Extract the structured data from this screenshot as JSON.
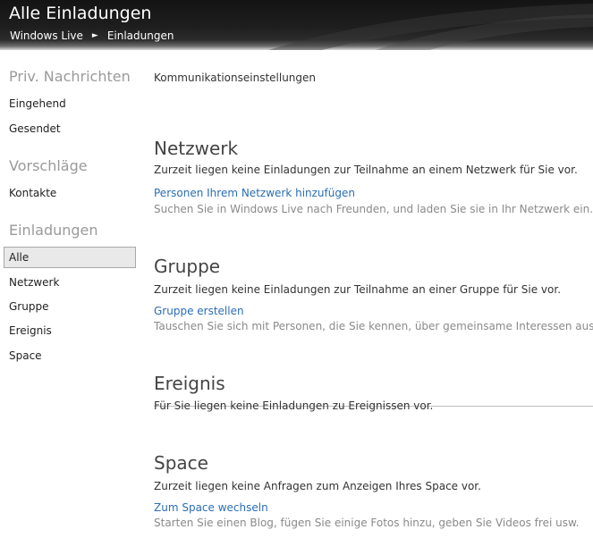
{
  "header": {
    "title": "Alle Einladungen",
    "breadcrumb": {
      "root": "Windows Live",
      "separator": "►",
      "current": "Einladungen"
    }
  },
  "sidebar": {
    "group_messages": {
      "heading": "Priv. Nachrichten",
      "items": [
        "Eingehend",
        "Gesendet"
      ]
    },
    "group_suggestions": {
      "heading": "Vorschläge",
      "items": [
        "Kontakte"
      ]
    },
    "group_invitations": {
      "heading": "Einladungen",
      "items": [
        "Alle",
        "Netzwerk",
        "Gruppe",
        "Ereignis",
        "Space"
      ],
      "selected": "Alle"
    }
  },
  "main": {
    "settings_link": "Kommunikationseinstellungen",
    "sections": [
      {
        "title": "Netzwerk",
        "text": "Zurzeit liegen keine Einladungen zur Teilnahme an einem Netzwerk für Sie vor.",
        "link": "Personen Ihrem Netzwerk hinzufügen",
        "hint": "Suchen Sie in Windows Live nach Freunden, und laden Sie sie in Ihr Netzwerk ein."
      },
      {
        "title": "Gruppe",
        "text": "Zurzeit liegen keine Einladungen zur Teilnahme an einer Gruppe für Sie vor.",
        "link": "Gruppe erstellen",
        "hint": "Tauschen Sie sich mit Personen, die Sie kennen, über gemeinsame Interessen aus."
      },
      {
        "title": "Ereignis",
        "text": "Für Sie liegen keine Einladungen zu Ereignissen vor."
      },
      {
        "title": "Space",
        "text": "Zurzeit liegen keine Anfragen zum Anzeigen Ihres Space vor.",
        "link": "Zum Space wechseln",
        "hint": "Starten Sie einen Blog, fügen Sie einige Fotos hinzu, geben Sie Videos frei usw."
      }
    ]
  },
  "colors": {
    "link": "#2a6eb3",
    "header_bg": "#1a1a1a",
    "heading_gray": "#9a9a9a",
    "selected_bg": "#e9e9e9",
    "hint_gray": "#8a8a8a"
  },
  "icons": {
    "breadcrumb_separator": "triangle-right-icon"
  }
}
